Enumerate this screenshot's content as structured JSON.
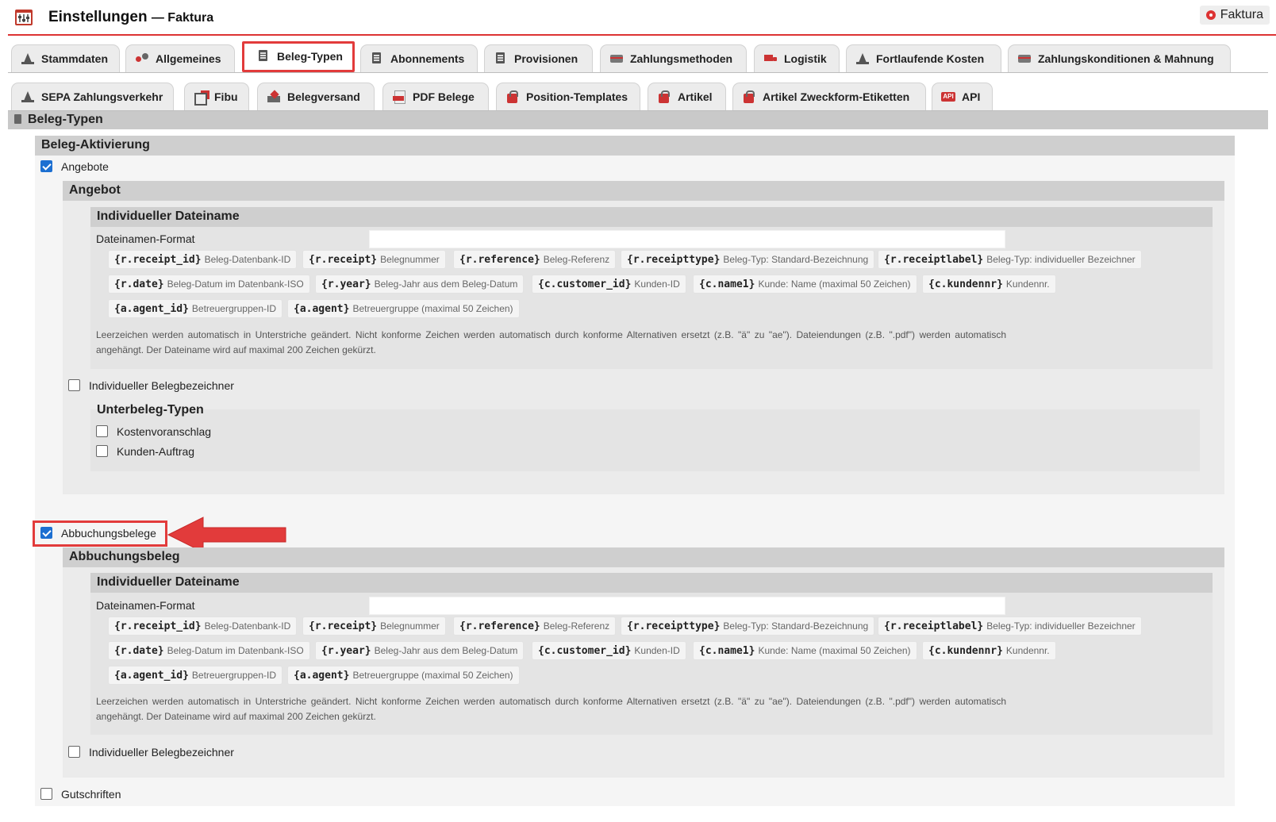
{
  "header": {
    "title": "Einstellungen",
    "subtitle": "— Faktura",
    "module_button": "Faktura"
  },
  "tabs_row1": [
    {
      "label": "Stammdaten",
      "icon": "cone-icon"
    },
    {
      "label": "Allgemeines",
      "icon": "gears-icon"
    },
    {
      "label": "Beleg-Typen",
      "icon": "document-icon",
      "active": true
    },
    {
      "label": "Abonnements",
      "icon": "document-icon"
    },
    {
      "label": "Provisionen",
      "icon": "document-icon"
    },
    {
      "label": "Zahlungsmethoden",
      "icon": "credit-card-icon"
    },
    {
      "label": "Logistik",
      "icon": "truck-icon"
    },
    {
      "label": "Fortlaufende Kosten",
      "icon": "cone-icon"
    },
    {
      "label": "Zahlungskonditionen & Mahnung",
      "icon": "credit-card-icon"
    }
  ],
  "tabs_row2": [
    {
      "label": "SEPA Zahlungsverkehr",
      "icon": "cone-icon"
    },
    {
      "label": "Fibu",
      "icon": "export-icon"
    },
    {
      "label": "Belegversand",
      "icon": "send-icon"
    },
    {
      "label": "PDF Belege",
      "icon": "pdf-icon"
    },
    {
      "label": "Position-Templates",
      "icon": "bag-icon"
    },
    {
      "label": "Artikel",
      "icon": "bag-icon"
    },
    {
      "label": "Artikel Zweckform-Etiketten",
      "icon": "bag-icon"
    },
    {
      "label": "API",
      "icon": "api-icon"
    }
  ],
  "section_title": "Beleg-Typen",
  "activation": {
    "title": "Beleg-Aktivierung",
    "angebote": {
      "label": "Angebote",
      "checked": true
    },
    "abbuchungsbelege": {
      "label": "Abbuchungsbelege",
      "checked": true
    },
    "gutschriften": {
      "label": "Gutschriften",
      "checked": false
    }
  },
  "angebot": {
    "title": "Angebot",
    "filename_title": "Individueller Dateiname",
    "format_label": "Dateinamen-Format",
    "format_value": "",
    "chips": [
      {
        "code": "{r.receipt_id}",
        "desc": "Beleg-Datenbank-ID"
      },
      {
        "code": "{r.receipt}",
        "desc": "Belegnummer"
      },
      {
        "code": "{r.reference}",
        "desc": "Beleg-Referenz"
      },
      {
        "code": "{r.receipttype}",
        "desc": "Beleg-Typ: Standard-Bezeichnung"
      },
      {
        "code": "{r.receiptlabel}",
        "desc": "Beleg-Typ: individueller Bezeichner"
      },
      {
        "code": "{r.date}",
        "desc": "Beleg-Datum im Datenbank-ISO"
      },
      {
        "code": "{r.year}",
        "desc": "Beleg-Jahr aus dem Beleg-Datum"
      },
      {
        "code": "{c.customer_id}",
        "desc": "Kunden-ID"
      },
      {
        "code": "{c.name1}",
        "desc": "Kunde: Name (maximal 50 Zeichen)"
      },
      {
        "code": "{c.kundennr}",
        "desc": "Kundennr."
      },
      {
        "code": "{a.agent_id}",
        "desc": "Betreuergruppen-ID"
      },
      {
        "code": "{a.agent}",
        "desc": "Betreuergruppe (maximal 50 Zeichen)"
      }
    ],
    "help_text": "Leerzeichen werden automatisch in Unterstriche geändert. Nicht konforme Zeichen werden automatisch durch konforme Alternativen ersetzt (z.B. \"ä\" zu \"ae\"). Dateiendungen (z.B. \".pdf\") werden automatisch angehängt. Der Dateiname wird auf maximal 200 Zeichen gekürzt.",
    "individual_label": {
      "label": "Individueller Belegbezeichner",
      "checked": false
    },
    "subtypes_title": "Unterbeleg-Typen",
    "subtypes": [
      {
        "label": "Kostenvoranschlag",
        "checked": false
      },
      {
        "label": "Kunden-Auftrag",
        "checked": false
      }
    ]
  },
  "abbuchungsbeleg": {
    "title": "Abbuchungsbeleg",
    "filename_title": "Individueller Dateiname",
    "format_label": "Dateinamen-Format",
    "format_value": "",
    "chips": [
      {
        "code": "{r.receipt_id}",
        "desc": "Beleg-Datenbank-ID"
      },
      {
        "code": "{r.receipt}",
        "desc": "Belegnummer"
      },
      {
        "code": "{r.reference}",
        "desc": "Beleg-Referenz"
      },
      {
        "code": "{r.receipttype}",
        "desc": "Beleg-Typ: Standard-Bezeichnung"
      },
      {
        "code": "{r.receiptlabel}",
        "desc": "Beleg-Typ: individueller Bezeichner"
      },
      {
        "code": "{r.date}",
        "desc": "Beleg-Datum im Datenbank-ISO"
      },
      {
        "code": "{r.year}",
        "desc": "Beleg-Jahr aus dem Beleg-Datum"
      },
      {
        "code": "{c.customer_id}",
        "desc": "Kunden-ID"
      },
      {
        "code": "{c.name1}",
        "desc": "Kunde: Name (maximal 50 Zeichen)"
      },
      {
        "code": "{c.kundennr}",
        "desc": "Kundennr."
      },
      {
        "code": "{a.agent_id}",
        "desc": "Betreuergruppen-ID"
      },
      {
        "code": "{a.agent}",
        "desc": "Betreuergruppe (maximal 50 Zeichen)"
      }
    ],
    "help_text": "Leerzeichen werden automatisch in Unterstriche geändert. Nicht konforme Zeichen werden automatisch durch konforme Alternativen ersetzt (z.B. \"ä\" zu \"ae\"). Dateiendungen (z.B. \".pdf\") werden automatisch angehängt. Der Dateiname wird auf maximal 200 Zeichen gekürzt.",
    "individual_label": {
      "label": "Individueller Belegbezeichner",
      "checked": false
    }
  },
  "colors": {
    "accent_red": "#e23b3b",
    "checkbox_blue": "#1c6fd1"
  }
}
